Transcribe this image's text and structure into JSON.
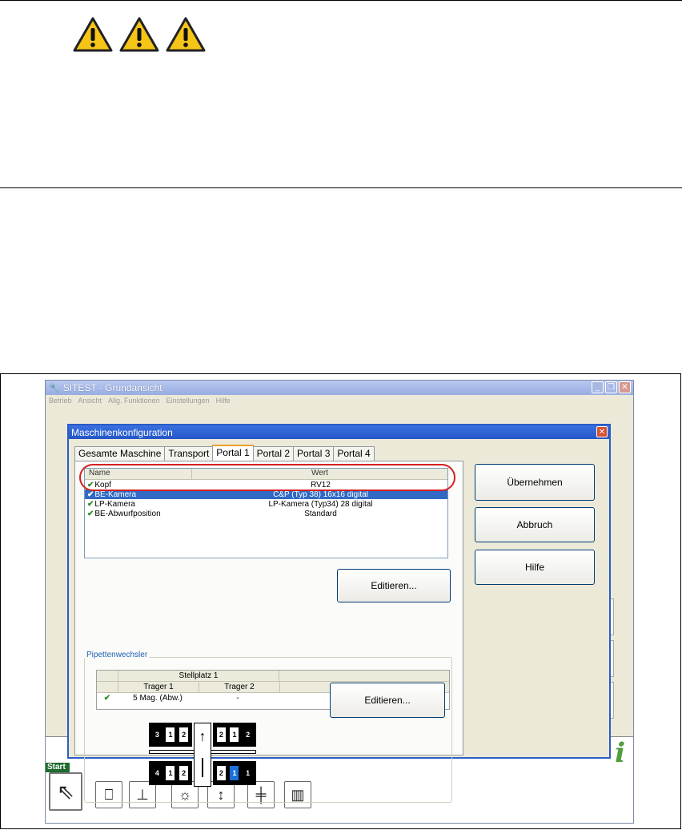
{
  "app": {
    "title": "SITEST - Grundansicht",
    "menu": [
      "Betrieb",
      "Ansicht",
      "Allg. Funktionen",
      "Einstellungen",
      "Hilfe"
    ],
    "start_label": "Start",
    "info_glyph": "i",
    "win_buttons": {
      "minimize": "_",
      "restore": "❐",
      "close": "✕"
    }
  },
  "dialog": {
    "title": "Maschinenkonfiguration",
    "close_glyph": "✕",
    "tabs": [
      {
        "label": "Gesamte Maschine",
        "active": false
      },
      {
        "label": "Transport",
        "active": false
      },
      {
        "label": "Portal 1",
        "active": true
      },
      {
        "label": "Portal 2",
        "active": false
      },
      {
        "label": "Portal 3",
        "active": false
      },
      {
        "label": "Portal 4",
        "active": false
      }
    ],
    "list": {
      "columns": [
        "Name",
        "Wert"
      ],
      "rows": [
        {
          "check": "✔",
          "name": "Kopf",
          "value": "RV12",
          "selected": false
        },
        {
          "check": "✔",
          "name": "BE-Kamera",
          "value": "C&P (Typ 38) 16x16 digital",
          "selected": true
        },
        {
          "check": "✔",
          "name": "LP-Kamera",
          "value": "LP-Kamera (Typ34) 28 digital",
          "selected": false
        },
        {
          "check": "✔",
          "name": "BE-Abwurfposition",
          "value": "Standard",
          "selected": false
        }
      ]
    },
    "edit_label": "Editieren...",
    "pipette": {
      "group_label": "Pipettenwechsler",
      "header_stellplatz": "Stellplatz 1",
      "col_1": "Trager 1",
      "col_2": "Trager 2",
      "row": {
        "check": "✔",
        "v1": "5 Mag. (Abw.)",
        "v2": "-"
      },
      "edit_label": "Editieren...",
      "diagram": {
        "top_left": [
          "3",
          "1",
          "2"
        ],
        "top_right": [
          "2",
          "1",
          "2"
        ],
        "bottom_left": [
          "4",
          "1",
          "2"
        ],
        "bottom_right": [
          "2",
          "1",
          "1"
        ],
        "highlight": "bottom_right.1",
        "arrow": "↑"
      }
    },
    "buttons": {
      "apply": "Übernehmen",
      "cancel": "Abbruch",
      "help": "Hilfe"
    }
  },
  "toolbar": {
    "icons": [
      "pointer-arrow-icon",
      "door-icon",
      "pcb-head-icon",
      "gear-icon",
      "feeder-icon",
      "transport-icon",
      "magazine-icon"
    ],
    "glyphs": [
      "⇖",
      "⎕",
      "⊥",
      "☼",
      "↕",
      "╪",
      "▥"
    ]
  },
  "colors": {
    "dialog_title": "#2456c8",
    "selection": "#316ac5",
    "highlight_slot": "#1b6fd8",
    "annotation": "#d42020",
    "start_tab": "#1d6b2e",
    "info_icon": "#4f9d3d"
  }
}
